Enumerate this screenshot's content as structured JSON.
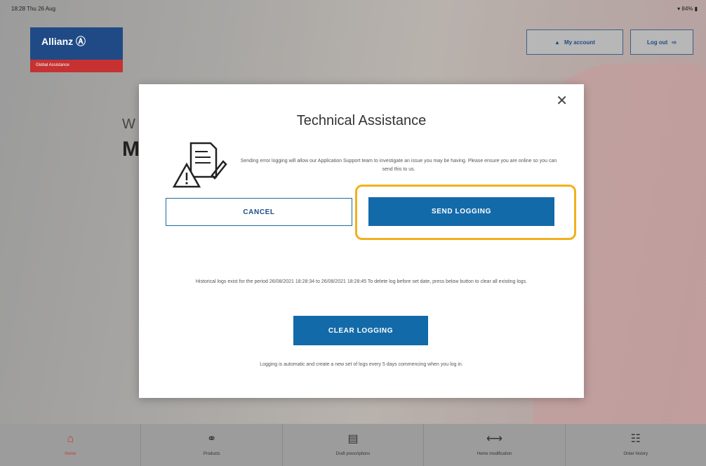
{
  "status_bar": {
    "time": "18:28  Thu 26 Aug",
    "right": "▾ 84% ▮"
  },
  "header": {
    "logo_name": "Allianz Ⓐ",
    "logo_tagline": "Global Assistance",
    "my_account_label": "My account",
    "logout_label": "Log out"
  },
  "background": {
    "greeting_partial": "W",
    "name_partial": "M"
  },
  "modal": {
    "title": "Technical Assistance",
    "close_glyph": "✕",
    "info_text": "Sending error logging will allow our Application Support team to investigate an issue you may be having. Please ensure you are online so you can send this to us.",
    "cancel_label": "CANCEL",
    "send_label": "SEND LOGGING",
    "history_text": "Historical logs exist for the period 26/08/2021 18:28:34 to 26/08/2021 18:28:45 To delete log before set date, press below button to clear all existing logs.",
    "clear_label": "CLEAR LOGGING",
    "auto_text": "Logging is automatic and create a new set of logs every 5 days commencing when you log in."
  },
  "tabbar": {
    "tabs": [
      {
        "label": "Home",
        "icon": "home-icon",
        "glyph": "⌂",
        "active": true
      },
      {
        "label": "Products",
        "icon": "products-icon",
        "glyph": "⚭",
        "active": false
      },
      {
        "label": "Draft prescriptions",
        "icon": "document-icon",
        "glyph": "▤",
        "active": false
      },
      {
        "label": "Home modification",
        "icon": "ruler-icon",
        "glyph": "⟷",
        "active": false
      },
      {
        "label": "Order history",
        "icon": "list-icon",
        "glyph": "☷",
        "active": false
      }
    ]
  },
  "colors": {
    "brand_blue": "#136aa9",
    "brand_red": "#c63232",
    "highlight": "#f2b01e"
  }
}
